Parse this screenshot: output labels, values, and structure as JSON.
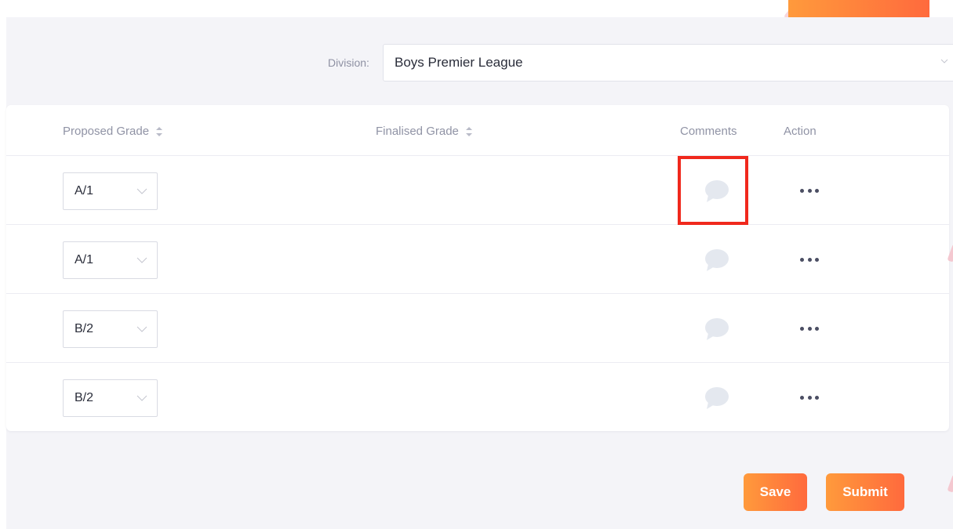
{
  "filter": {
    "division_label": "Division:",
    "division_value": "Boys Premier League"
  },
  "table": {
    "headers": {
      "proposed_grade": "Proposed Grade",
      "finalised_grade": "Finalised Grade",
      "comments": "Comments",
      "action": "Action"
    },
    "rows": [
      {
        "proposed_grade": "A/1",
        "finalised_grade": "",
        "has_comment": false
      },
      {
        "proposed_grade": "A/1",
        "finalised_grade": "",
        "has_comment": false
      },
      {
        "proposed_grade": "B/2",
        "finalised_grade": "",
        "has_comment": false
      },
      {
        "proposed_grade": "B/2",
        "finalised_grade": "",
        "has_comment": false
      }
    ]
  },
  "icons": {
    "sort": "sort-icon",
    "comment": "comment-bubble-icon",
    "more": "more-horizontal-icon",
    "chevron": "chevron-down-icon"
  },
  "footer": {
    "save_label": "Save",
    "submit_label": "Submit"
  },
  "colors": {
    "accent_start": "#ff9a3c",
    "accent_end": "#ff6a3d",
    "highlight": "#f0281c",
    "background": "#f4f4f8",
    "comment_icon": "#e4e8ef"
  }
}
